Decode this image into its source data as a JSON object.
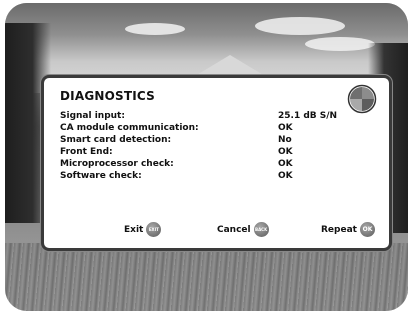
{
  "dialog": {
    "title": "DIAGNOSTICS",
    "rows": [
      {
        "label": "Signal input:",
        "value": "25.1 dB S/N"
      },
      {
        "label": "CA module communication:",
        "value": "OK"
      },
      {
        "label": "Smart card detection:",
        "value": "No"
      },
      {
        "label": "Front End:",
        "value": "OK"
      },
      {
        "label": "Microprocessor check:",
        "value": "OK"
      },
      {
        "label": "Software check:",
        "value": "OK"
      }
    ]
  },
  "footer": {
    "exit_label": "Exit",
    "exit_key": "EXIT",
    "cancel_label": "Cancel",
    "cancel_key": "BACK",
    "repeat_label": "Repeat",
    "repeat_key": "OK"
  },
  "icons": {
    "brand_logo": "quartered-circle-logo",
    "exit_key": "exit-remote-key-icon",
    "cancel_key": "back-remote-key-icon",
    "repeat_key": "ok-remote-key-icon"
  }
}
